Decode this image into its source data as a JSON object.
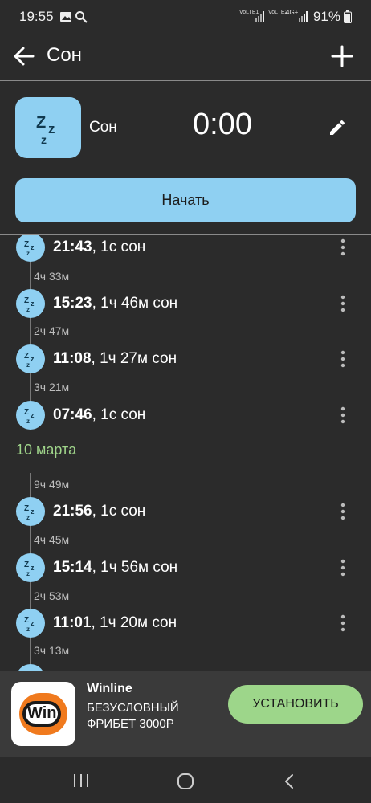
{
  "status_bar": {
    "time": "19:55",
    "sim1": "VoLTE1",
    "sim2": "VoLTE2",
    "network": "4G+",
    "battery": "91%"
  },
  "app_bar": {
    "title": "Сон",
    "back_icon": "arrow-back-icon",
    "add_icon": "plus-icon"
  },
  "activity": {
    "icon": "sleep-zzz-icon",
    "name": "Сон",
    "timer": "0:00",
    "edit_icon": "pencil-icon"
  },
  "start_button": {
    "label": "Начать"
  },
  "timeline": {
    "entries": [
      {
        "time": "21:43",
        "duration": ", 1с сон"
      },
      {
        "time": "15:23",
        "duration": ", 1ч 46м сон"
      },
      {
        "time": "11:08",
        "duration": ", 1ч 27м сон"
      },
      {
        "time": "07:46",
        "duration": ", 1с сон"
      },
      {
        "time": "21:56",
        "duration": ", 1с сон"
      },
      {
        "time": "15:14",
        "duration": ", 1ч 56м сон"
      },
      {
        "time": "11:01",
        "duration": ", 1ч 20м сон"
      }
    ],
    "gaps": [
      "4ч 33м",
      "2ч 47м",
      "3ч 21м",
      "9ч 49м",
      "4ч 45м",
      "2ч 53м",
      "3ч 13м"
    ],
    "date_header": "10 марта"
  },
  "ad": {
    "brand": "Winline",
    "text": "БЕЗУСЛОВНЫЙ ФРИБЕТ 3000Р",
    "logo_text": "Win",
    "button": "УСТАНОВИТЬ",
    "colors": {
      "logo_orange": "#f07a1e",
      "button_green": "#9dd68a"
    }
  },
  "colors": {
    "background": "#2b2b2b",
    "accent_blue": "#8fd0f2",
    "date_green": "#9fd48a"
  }
}
